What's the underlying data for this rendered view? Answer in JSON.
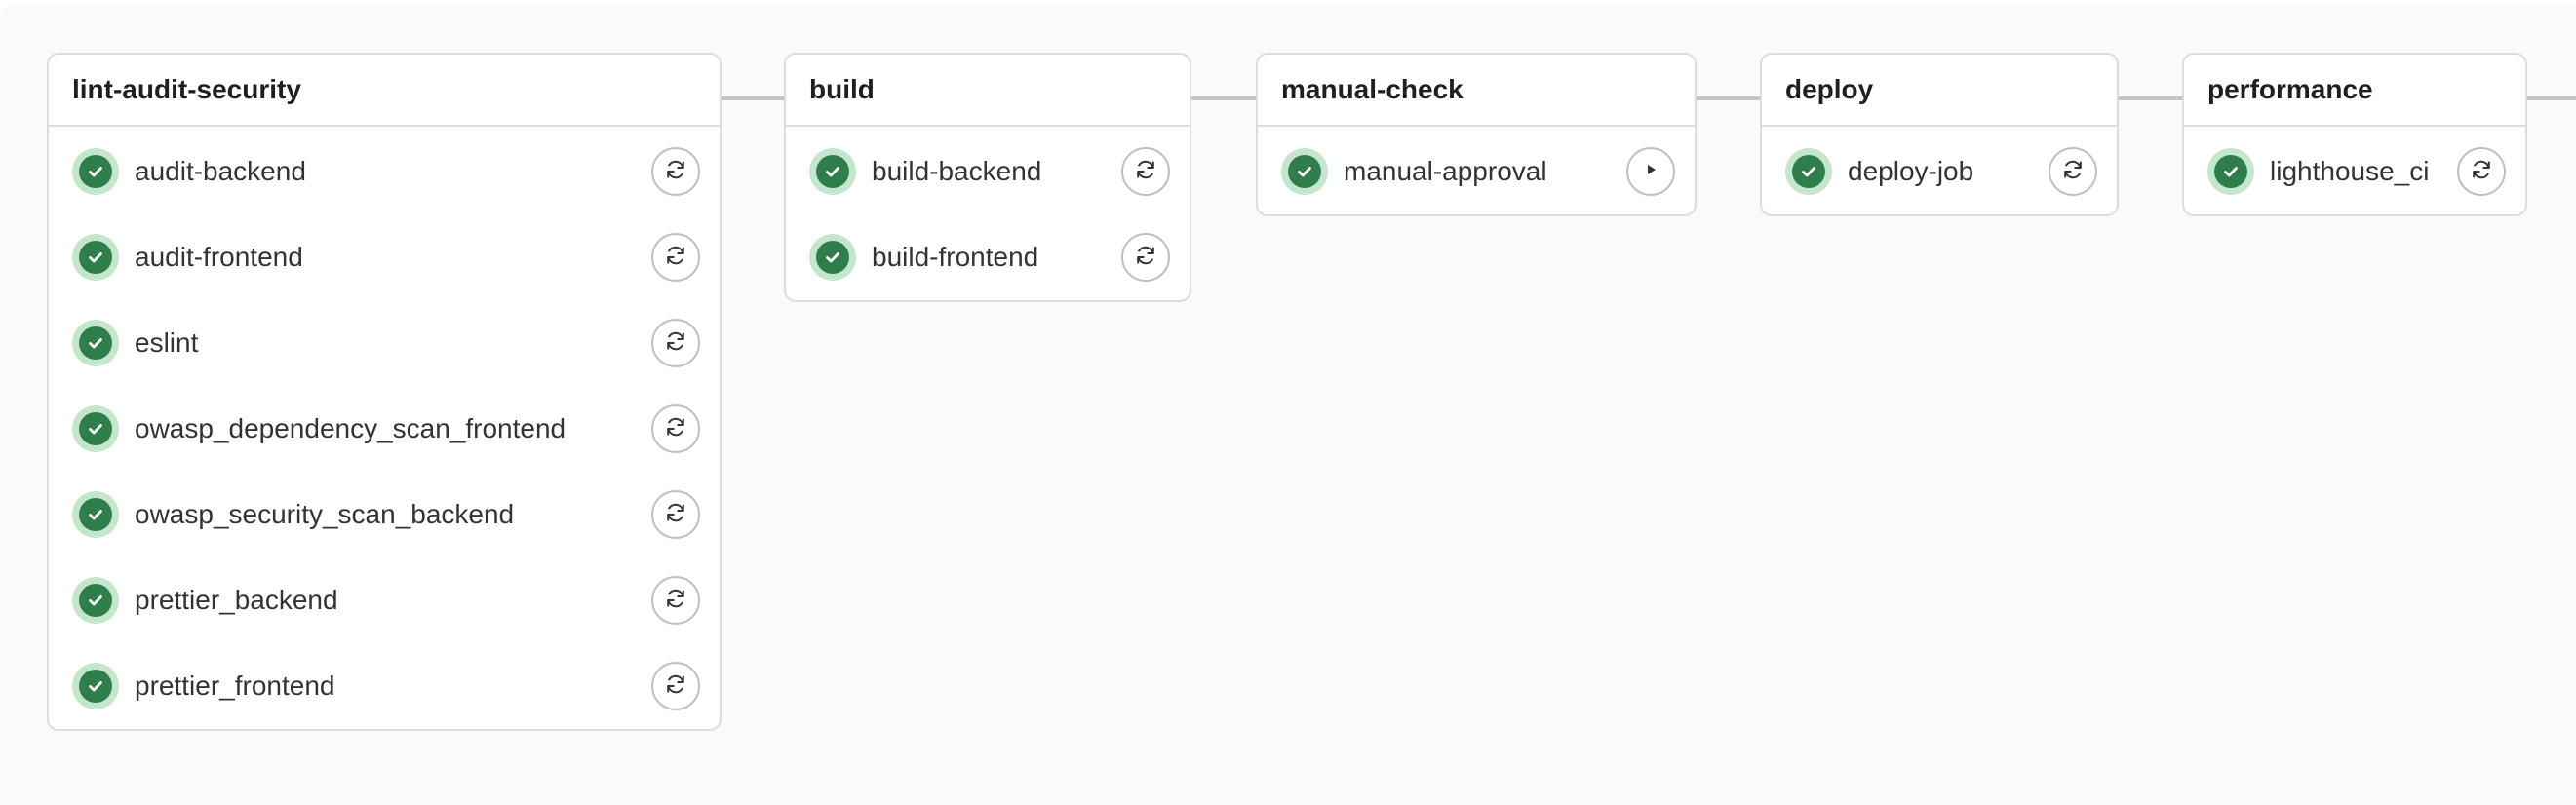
{
  "stages": [
    {
      "name": "lint-audit-security",
      "jobs": [
        {
          "name": "audit-backend",
          "status": "success",
          "action": "retry-icon"
        },
        {
          "name": "audit-frontend",
          "status": "success",
          "action": "retry-icon"
        },
        {
          "name": "eslint",
          "status": "success",
          "action": "retry-icon"
        },
        {
          "name": "owasp_dependency_scan_frontend",
          "status": "success",
          "action": "retry-icon"
        },
        {
          "name": "owasp_security_scan_backend",
          "status": "success",
          "action": "retry-icon"
        },
        {
          "name": "prettier_backend",
          "status": "success",
          "action": "retry-icon"
        },
        {
          "name": "prettier_frontend",
          "status": "success",
          "action": "retry-icon"
        }
      ]
    },
    {
      "name": "build",
      "jobs": [
        {
          "name": "build-backend",
          "status": "success",
          "action": "retry-icon"
        },
        {
          "name": "build-frontend",
          "status": "success",
          "action": "retry-icon"
        }
      ]
    },
    {
      "name": "manual-check",
      "jobs": [
        {
          "name": "manual-approval",
          "status": "success",
          "action": "play-icon"
        }
      ]
    },
    {
      "name": "deploy",
      "jobs": [
        {
          "name": "deploy-job",
          "status": "success",
          "action": "retry-icon"
        }
      ]
    },
    {
      "name": "performance",
      "jobs": [
        {
          "name": "lighthouse_ci",
          "status": "success",
          "action": "retry-icon"
        }
      ]
    }
  ],
  "colors": {
    "success_fill": "#2f7d4b",
    "success_ring": "#c3e6cd",
    "border": "#dcdcde",
    "connector": "#c4c4c8",
    "background": "#fafafc"
  }
}
